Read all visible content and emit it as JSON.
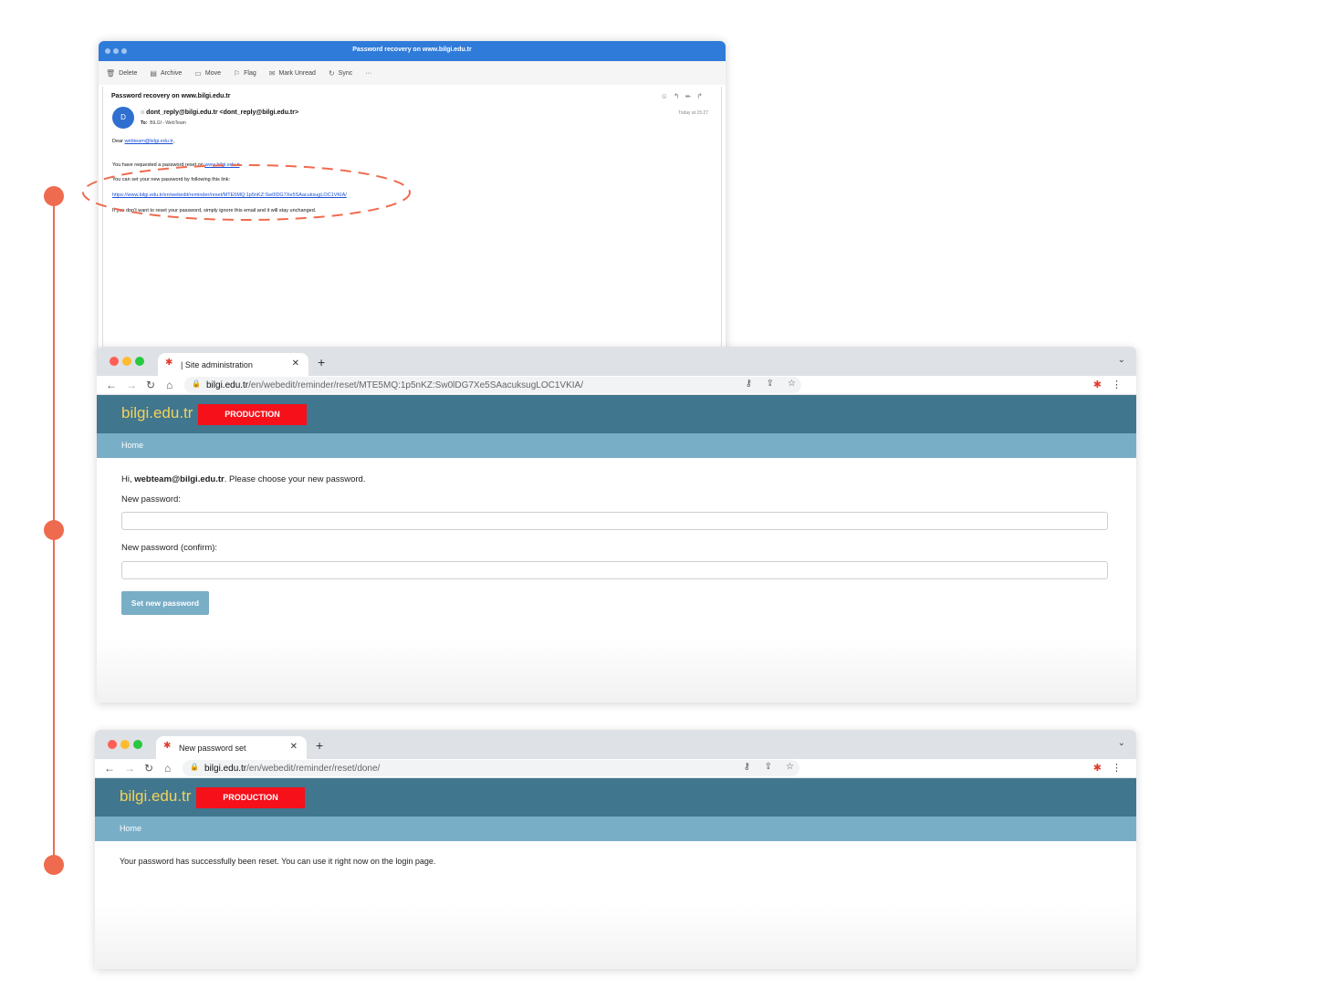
{
  "colors": {
    "timeline": "#ef6b4f",
    "mail_titlebar": "#2f7bd9",
    "site_header": "#41768f",
    "site_nav": "#79aec7",
    "brand": "#f3d35a",
    "production_badge": "#f5101a"
  },
  "mail": {
    "window_title": "Password recovery on www.bilgi.edu.tr",
    "toolbar": {
      "delete": "Delete",
      "archive": "Archive",
      "move": "Move",
      "flag": "Flag",
      "mark_unread": "Mark Unread",
      "sync": "Sync",
      "more": "···"
    },
    "subject": "Password recovery on www.bilgi.edu.tr",
    "avatar_letter": "D",
    "from": "○ dont_reply@bilgi.edu.tr <dont_reply@bilgi.edu.tr>",
    "to_label": "To:",
    "to_value": "BILGI - WebTeam",
    "date": "Today at 15:27",
    "greeting_prefix": "Dear ",
    "greeting_email": "webteam@bilgi.edu.tr",
    "greeting_suffix": ",",
    "line1_prefix": "You have requested a password reset on ",
    "line1_link": "www.bilgi.edu.tr",
    "line1_suffix": ".",
    "line2": "You can set your new password by following this link:",
    "reset_link": "https://www.bilgi.edu.tr/en/webedit/reminder/reset/MTE5MQ:1p5nKZ:Sw0lDG7Xe5SAacuksugLOC1VKIA/",
    "line3": "If you don't want to reset your password, simply ignore this email and it will stay unchanged."
  },
  "browser1": {
    "tab_title": "| Site administration",
    "url_host": "bilgi.edu.tr",
    "url_path": "/en/webedit/reminder/reset/MTE5MQ:1p5nKZ:Sw0lDG7Xe5SAacuksugLOC1VKIA/",
    "brand": "bilgi.edu.tr",
    "badge": "PRODUCTION",
    "nav_home": "Home",
    "intro_prefix": "Hi, ",
    "intro_user": "webteam@bilgi.edu.tr",
    "intro_suffix": ". Please choose your new password.",
    "new_password_label": "New password:",
    "confirm_label": "New password (confirm):",
    "submit": "Set new password"
  },
  "browser2": {
    "tab_title": "New password set",
    "url_host": "bilgi.edu.tr",
    "url_path": "/en/webedit/reminder/reset/done/",
    "brand": "bilgi.edu.tr",
    "badge": "PRODUCTION",
    "nav_home": "Home",
    "message": "Your password has successfully been reset. You can use it right now on the login page."
  }
}
